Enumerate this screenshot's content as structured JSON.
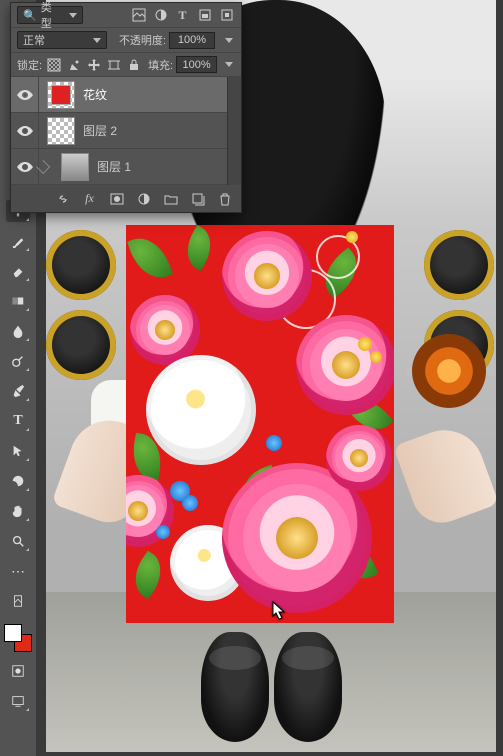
{
  "layersPanel": {
    "filterLabel": "类型",
    "blendMode": "正常",
    "opacityLabel": "不透明度:",
    "opacityValue": "100%",
    "lockLabel": "锁定:",
    "fillLabel": "填充:",
    "fillValue": "100%",
    "layers": [
      {
        "name": "花纹",
        "visible": true,
        "selected": true
      },
      {
        "name": "图层 2",
        "visible": true,
        "selected": false
      },
      {
        "name": "图层 1",
        "visible": true,
        "selected": false
      }
    ]
  },
  "icons": {
    "search": "⌕",
    "eye": "👁"
  }
}
